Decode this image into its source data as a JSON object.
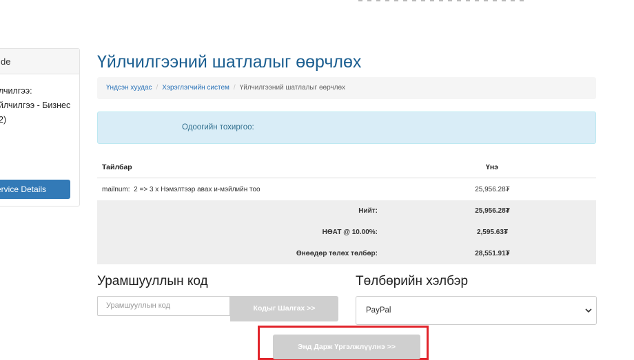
{
  "sidebar": {
    "header": "de",
    "lines": [
      "лчилгээ:",
      "йлчилгээ - Бизнес",
      "2)"
    ],
    "service_details_button": "ervice Details"
  },
  "page": {
    "title": "Үйлчилгээний шатлалыг өөрчлөх"
  },
  "breadcrumb": {
    "items": [
      "Үндсэн хуудас",
      "Хэрэглэгчийн систем"
    ],
    "current": "Үйлчилгээний шатлалыг өөрчлөх",
    "separator": "/"
  },
  "info": {
    "text": "Одоогийн тохиргоо:"
  },
  "summary": {
    "headers": {
      "description": "Тайлбар",
      "price": "Үнэ"
    },
    "item": {
      "prefix": "mailnum:",
      "from": "2",
      "arrow": "=>",
      "to": "3",
      "suffix": "x Нэмэлтээр авах и-мэйлийн тоо",
      "price": "25,956.28₮"
    },
    "totals": [
      {
        "label": "Нийт:",
        "value": "25,956.28₮"
      },
      {
        "label": "НӨАТ @ 10.00%:",
        "value": "2,595.63₮"
      },
      {
        "label": "Өнөөдөр төлөх төлбөр:",
        "value": "28,551.91₮"
      }
    ]
  },
  "promo": {
    "heading": "Урамшууллын код",
    "placeholder": "Урамшууллын код",
    "button": "Кодыг Шалгах >>"
  },
  "payment": {
    "heading": "Төлбөрийн хэлбэр",
    "selected": "PayPal"
  },
  "continue_button": "Энд Дарж Үргэлжлүүлнэ >>",
  "colors": {
    "title": "#1c5f91",
    "link": "#2a73b8",
    "info_bg": "#d9edf7",
    "primary_button": "#337ab7",
    "disabled_button": "#cfcfcf",
    "highlight_box": "#e1242b"
  }
}
